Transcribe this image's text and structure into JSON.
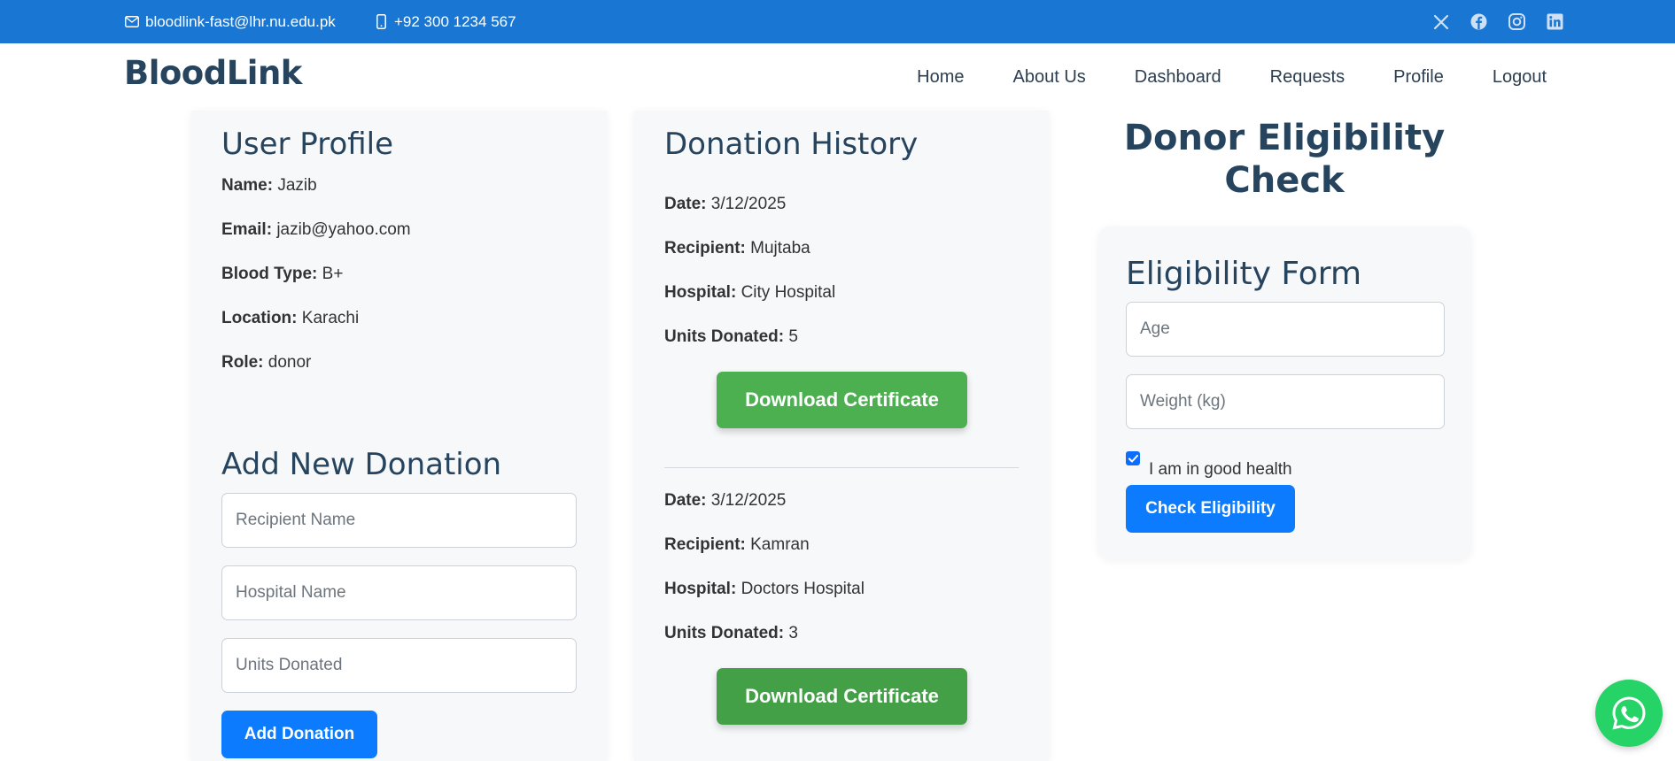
{
  "topbar": {
    "email": "bloodlink-fast@lhr.nu.edu.pk",
    "phone": "+92 300 1234 567",
    "social": [
      "x-icon",
      "facebook-icon",
      "instagram-icon",
      "linkedin-icon"
    ]
  },
  "navbar": {
    "brand": "BloodLink",
    "links": [
      "Home",
      "About Us",
      "Dashboard",
      "Requests",
      "Profile",
      "Logout"
    ]
  },
  "profile": {
    "title": "User Profile",
    "name_label": "Name:",
    "name": "Jazib",
    "email_label": "Email:",
    "email": "jazib@yahoo.com",
    "blood_label": "Blood Type:",
    "blood": "B+",
    "location_label": "Location:",
    "location": "Karachi",
    "role_label": "Role:",
    "role": "donor"
  },
  "add_donation": {
    "title": "Add New Donation",
    "recipient_placeholder": "Recipient Name",
    "hospital_placeholder": "Hospital Name",
    "units_placeholder": "Units Donated",
    "button": "Add Donation"
  },
  "history": {
    "title": "Donation History",
    "date_label": "Date:",
    "recipient_label": "Recipient:",
    "hospital_label": "Hospital:",
    "units_label": "Units Donated:",
    "button": "Download Certificate",
    "entries": [
      {
        "date": "3/12/2025",
        "recipient": "Mujtaba",
        "hospital": "City Hospital",
        "units": "5"
      },
      {
        "date": "3/12/2025",
        "recipient": "Kamran",
        "hospital": "Doctors Hospital",
        "units": "3"
      }
    ]
  },
  "eligibility": {
    "heading_line1": "Donor Eligibility",
    "heading_line2": "Check",
    "form_title": "Eligibility Form",
    "age_placeholder": "Age",
    "weight_placeholder": "Weight (kg)",
    "health_label": "I am in good health",
    "health_checked": true,
    "button": "Check Eligibility"
  },
  "colors": {
    "topbar": "#1976d2",
    "heading": "#27445e",
    "primary_button": "#0d7bfd",
    "certificate_button_1": "#4caf50",
    "certificate_button_2": "#43a047",
    "whatsapp": "#25d366"
  }
}
